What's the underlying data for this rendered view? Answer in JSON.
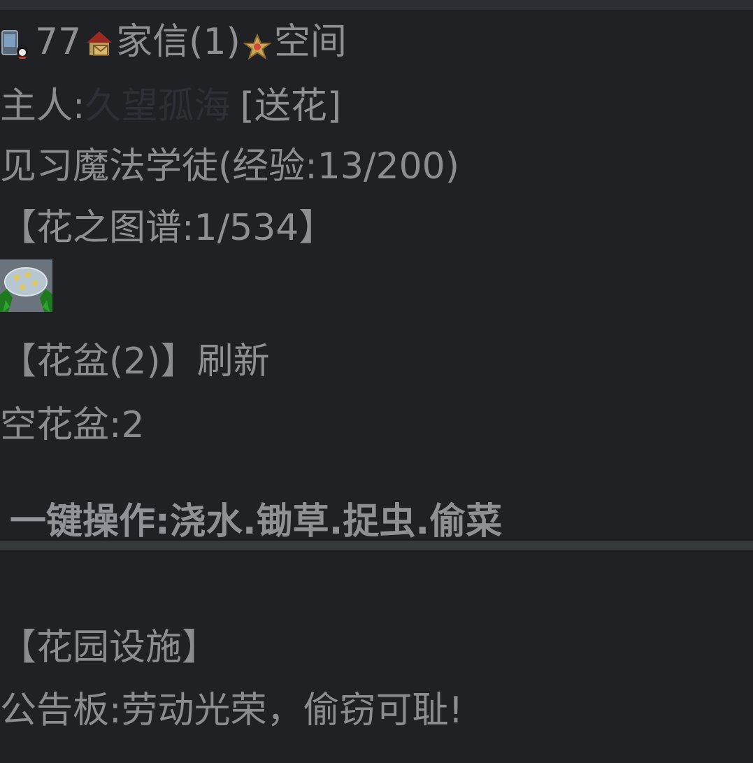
{
  "nav": {
    "phone_icon": "phone-qq-icon",
    "count": "77",
    "house_icon": "house-mail-icon",
    "mail_label": "家信(1)",
    "star_icon": "star-icon",
    "space_label": "空间"
  },
  "owner": {
    "label": "主人:",
    "name": "久望孤海",
    "send_flower": "[送花]"
  },
  "rank": {
    "text": "见习魔法学徒(经验:13/200)"
  },
  "atlas": {
    "text": "【花之图谱:1/534】"
  },
  "garden_image": "flower-garden-image",
  "pots": {
    "label": "【花盆(2)】",
    "refresh": "刷新"
  },
  "empty_pots": {
    "text": "空花盆:2"
  },
  "one_key": {
    "label": "一键操作:",
    "water": "浇水",
    "dot1": ".",
    "weed": "锄草",
    "dot2": ".",
    "bug": "捉虫",
    "dot3": ".",
    "steal": "偷菜"
  },
  "facilities": {
    "title": "【花园设施】"
  },
  "notice": {
    "text": "公告板:劳动光荣，偷窃可耻!"
  },
  "colors": {
    "background": "#202125",
    "text": "#8b8d91",
    "owner_name": "#2c3036",
    "divider": "#363a3f"
  }
}
